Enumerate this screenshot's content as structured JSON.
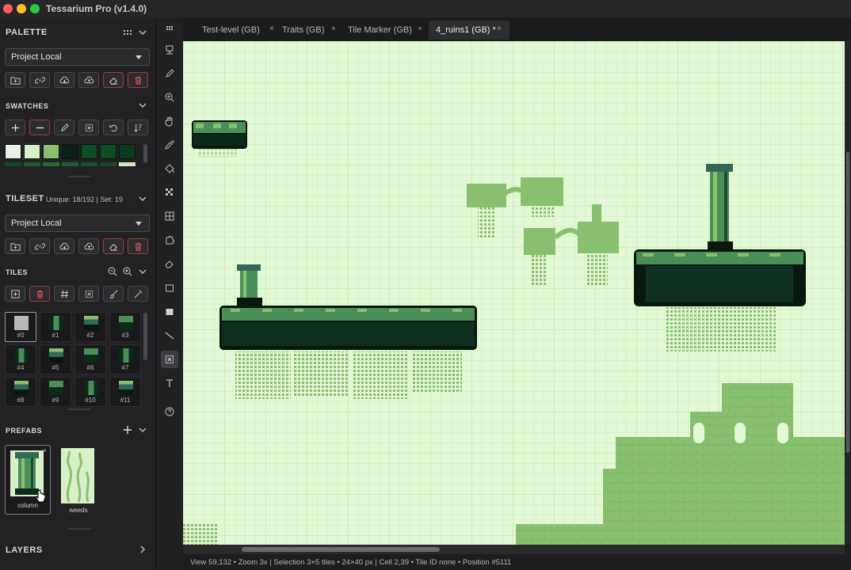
{
  "app": {
    "title": "Tessarium Pro (v1.4.0)"
  },
  "palette": {
    "section_title": "PALETTE",
    "source": "Project Local",
    "buttons": [
      "folder-plus-icon",
      "link-icon",
      "cloud-download-icon",
      "cloud-upload-icon",
      "eraser-icon",
      "trash-icon"
    ]
  },
  "swatches": {
    "section_title": "SWATCHES",
    "buttons": [
      "plus-icon",
      "minus-icon",
      "pencil-icon",
      "select-icon",
      "undo-icon",
      "sort-icon"
    ],
    "colors": [
      "#e9f2e4",
      "#d8f0c8",
      "#88c070",
      "#0c2218",
      "#0f4d24",
      "#0f4d24",
      "#0c3a1c"
    ],
    "colors_row2": [
      "#164a22",
      "#1d5b2b",
      "#236b31",
      "#1f5f2d",
      "#19522a",
      "#154924",
      "#cfe6bf"
    ]
  },
  "tileset": {
    "section_title": "TILESET",
    "stats": "Unique: 18/192 | Set: 19",
    "source": "Project Local"
  },
  "tiles": {
    "section_title": "TILES",
    "items": [
      "#0",
      "#1",
      "#2",
      "#3",
      "#4",
      "#5",
      "#6",
      "#7",
      "#8",
      "#9",
      "#10",
      "#11"
    ]
  },
  "prefabs": {
    "section_title": "PREFABS",
    "items": [
      {
        "label": "column",
        "close": "×"
      },
      {
        "label": "weeds"
      }
    ]
  },
  "layers": {
    "section_title": "LAYERS"
  },
  "tabs": [
    {
      "label": "Test-level (GB)",
      "close": "×"
    },
    {
      "label": "Traits (GB)",
      "close": "×"
    },
    {
      "label": "Tile Marker (GB)",
      "close": "×"
    },
    {
      "label": "4_ruins1 (GB) *",
      "close": "×"
    }
  ],
  "status": {
    "text": "View 59,132 • Zoom 3x | Selection 3×5 tiles • 24×40 px | Cell 2,39 • Tile ID none • Position #5111"
  },
  "colors": {
    "canvas_bg": "#e3f8d5",
    "grid": "#c8e6b4",
    "light_green": "#88c070",
    "mid_green": "#346856",
    "dark_green": "#08180f",
    "moss": "#4a8f57"
  }
}
